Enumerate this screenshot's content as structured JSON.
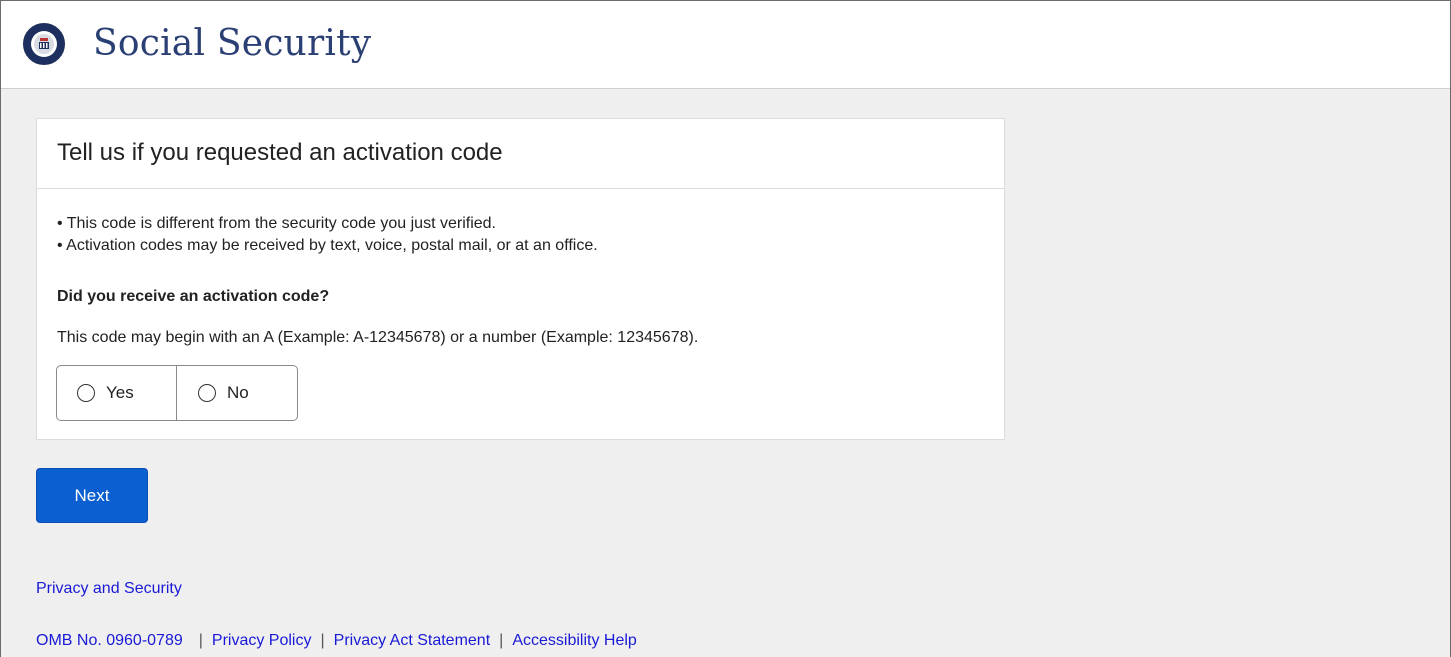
{
  "header": {
    "brand": "Social Security"
  },
  "card": {
    "title": "Tell us if you requested an activation code",
    "bullets": [
      "• This code is different from the security code you just verified.",
      "• Activation codes may be received by text, voice, postal mail, or at an office."
    ],
    "question": "Did you receive an activation code?",
    "hint": "This code may begin with an A (Example: A-12345678) or a number (Example: 12345678).",
    "options": [
      {
        "label": "Yes",
        "selected": false
      },
      {
        "label": "No",
        "selected": false
      }
    ]
  },
  "actions": {
    "next_label": "Next"
  },
  "footer": {
    "privacy_security": "Privacy and Security",
    "omb": "OMB No. 0960-0789",
    "links": [
      "Privacy Policy",
      "Privacy Act Statement",
      "Accessibility Help"
    ],
    "separator": "|"
  },
  "colors": {
    "primary_button": "#0b5fd1",
    "brand_text": "#2a3f73",
    "link": "#1a1ad6",
    "background": "#efefef"
  }
}
